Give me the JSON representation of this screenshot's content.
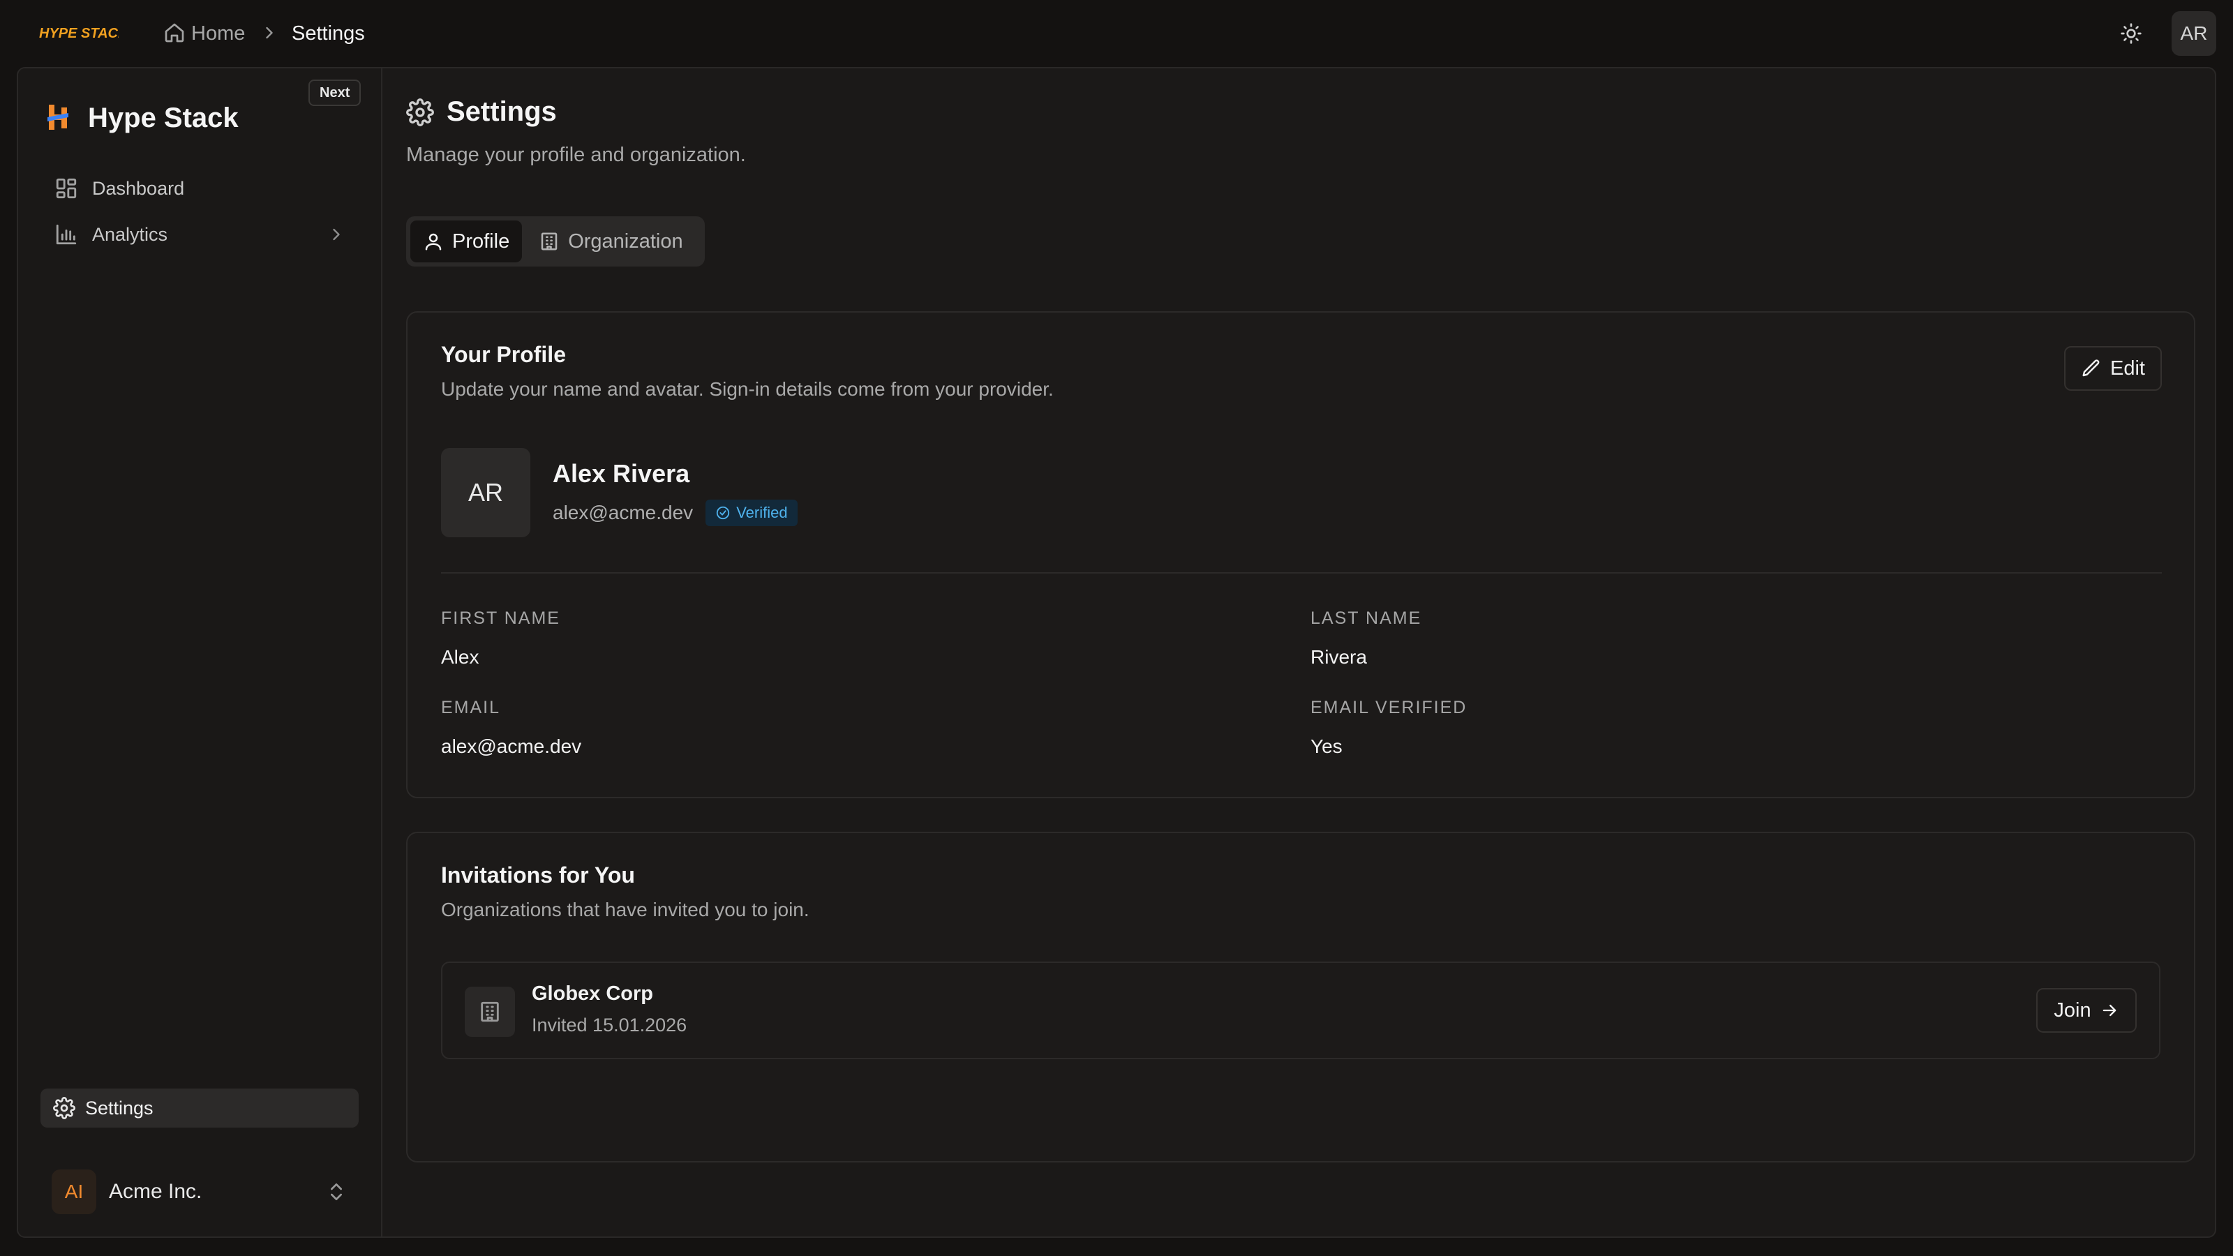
{
  "topbar": {
    "logo_text": "HYPE STACK",
    "breadcrumb": {
      "home": "Home",
      "current": "Settings"
    },
    "avatar_initials": "AR"
  },
  "sidebar": {
    "brand": "Hype Stack",
    "badge": "Next",
    "nav": [
      {
        "label": "Dashboard",
        "icon": "dashboard-icon"
      },
      {
        "label": "Analytics",
        "icon": "chart-bar-icon"
      }
    ],
    "settings_label": "Settings",
    "org": {
      "initials": "AI",
      "name": "Acme Inc."
    }
  },
  "page": {
    "title": "Settings",
    "subtitle": "Manage your profile and organization."
  },
  "tabs": [
    {
      "label": "Profile",
      "active": true
    },
    {
      "label": "Organization",
      "active": false
    }
  ],
  "profile_card": {
    "title": "Your Profile",
    "subtitle": "Update your name and avatar. Sign-in details come from your provider.",
    "edit_label": "Edit",
    "avatar_initials": "AR",
    "name": "Alex Rivera",
    "email": "alex@acme.dev",
    "verified_label": "Verified",
    "fields": {
      "first_name_label": "FIRST NAME",
      "first_name": "Alex",
      "last_name_label": "LAST NAME",
      "last_name": "Rivera",
      "email_label": "EMAIL",
      "email": "alex@acme.dev",
      "email_verified_label": "EMAIL VERIFIED",
      "email_verified": "Yes"
    }
  },
  "invitations_card": {
    "title": "Invitations for You",
    "subtitle": "Organizations that have invited you to join.",
    "items": [
      {
        "org": "Globex Corp",
        "invited": "Invited 15.01.2026",
        "action": "Join"
      }
    ]
  },
  "colors": {
    "background": "#141211",
    "panel": "#1b1918",
    "accent_orange": "#f28a2e",
    "verified_blue": "#4fb3ee"
  }
}
